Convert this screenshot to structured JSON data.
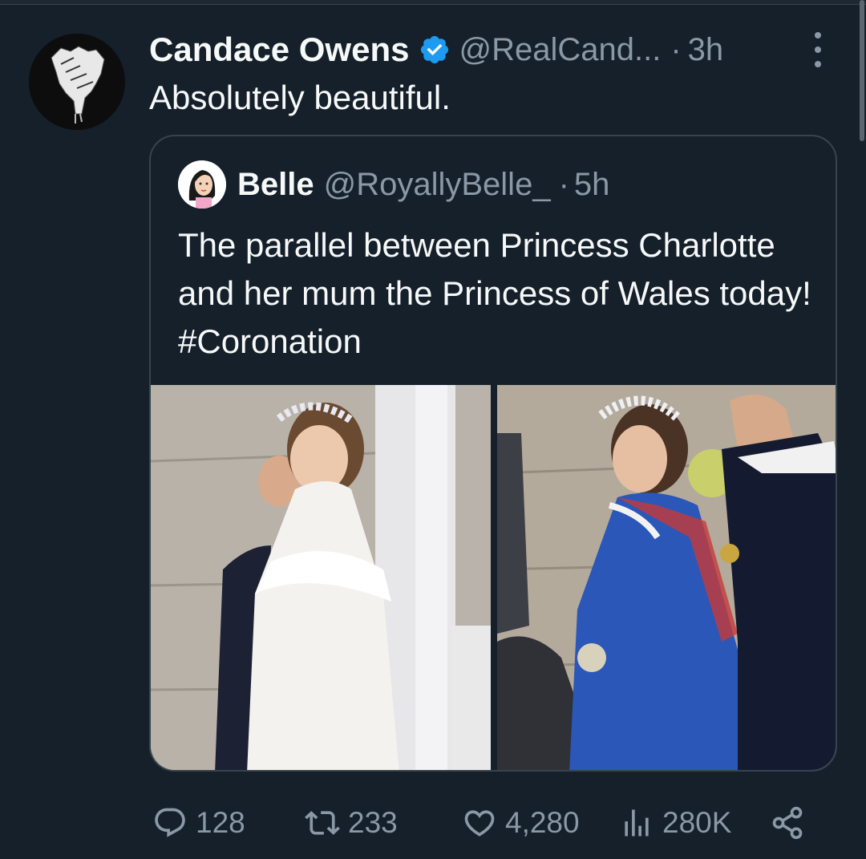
{
  "tweet": {
    "display_name": "Candace Owens",
    "handle": "@RealCand...",
    "separator": "·",
    "time": "3h",
    "text": "Absolutely beautiful."
  },
  "quoted_tweet": {
    "display_name": "Belle",
    "handle": "@RoyallyBelle_",
    "separator": "·",
    "time": "5h",
    "text": "The parallel between Princess Charlotte and her mum the Princess of Wales today! #Coronation"
  },
  "actions": {
    "replies": "128",
    "retweets": "233",
    "likes": "4,280",
    "views": "280K"
  },
  "icons": {
    "more": "more-vertical-icon",
    "verified": "verified-badge-icon",
    "reply": "reply-icon",
    "retweet": "retweet-icon",
    "like": "heart-icon",
    "views": "views-icon",
    "share": "share-icon"
  },
  "colors": {
    "background": "#15202b",
    "text_primary": "#f7f9f9",
    "text_secondary": "#8b98a5",
    "border": "#38444d",
    "verified": "#1d9bf0"
  }
}
